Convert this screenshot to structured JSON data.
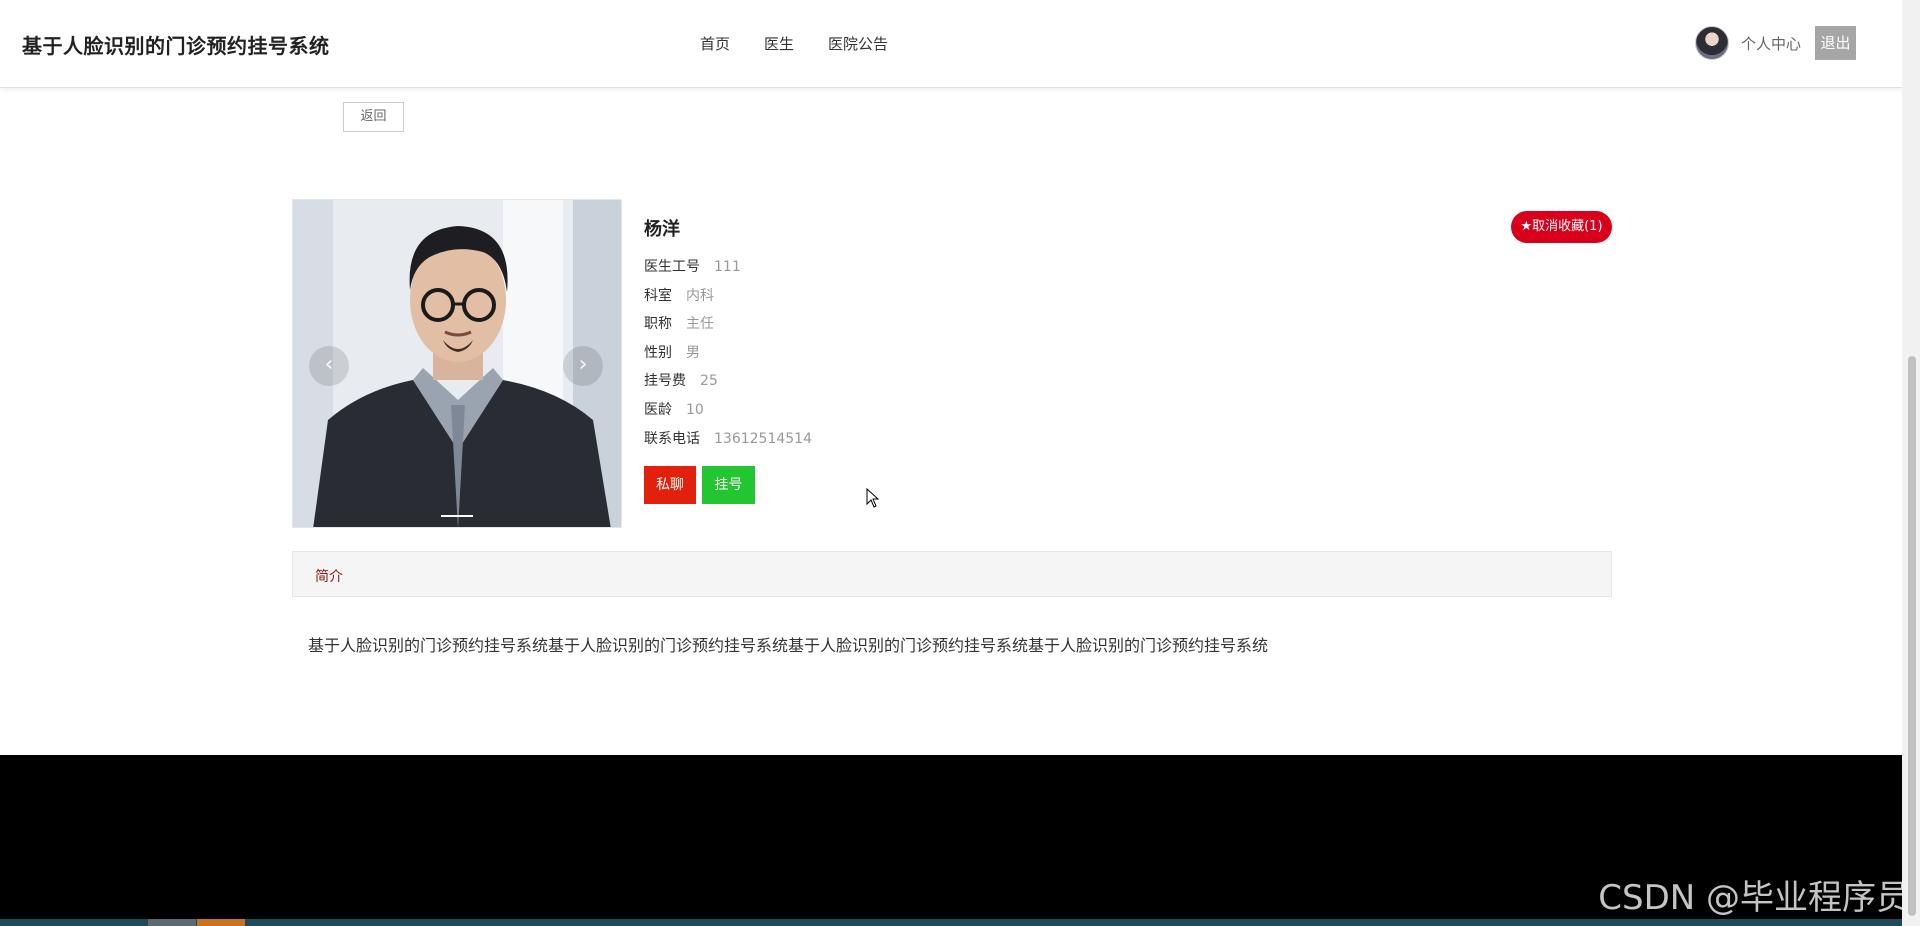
{
  "header": {
    "brand": "基于人脸识别的门诊预约挂号系统",
    "nav": [
      "首页",
      "医生",
      "医院公告"
    ],
    "user_center": "个人中心",
    "logout": "退出"
  },
  "back_label": "返回",
  "doctor": {
    "name": "杨洋",
    "favorite_label": "★取消收藏(1)",
    "fields": [
      {
        "label": "医生工号",
        "value": "111"
      },
      {
        "label": "科室",
        "value": "内科"
      },
      {
        "label": "职称",
        "value": "主任"
      },
      {
        "label": "性别",
        "value": "男"
      },
      {
        "label": "挂号费",
        "value": "25"
      },
      {
        "label": "医龄",
        "value": "10"
      },
      {
        "label": "联系电话",
        "value": "13612514514"
      }
    ],
    "chat_label": "私聊",
    "register_label": "挂号"
  },
  "carousel": {
    "prev_icon": "chevron-left-icon",
    "next_icon": "chevron-right-icon"
  },
  "intro": {
    "tab_label": "简介",
    "text": "基于人脸识别的门诊预约挂号系统基于人脸识别的门诊预约挂号系统基于人脸识别的门诊预约挂号系统基于人脸识别的门诊预约挂号系统"
  },
  "watermark": "CSDN @毕业程序员",
  "colors": {
    "favorite": "#d9001b",
    "chat": "#e3200b",
    "register": "#22c631",
    "intro_tab_text": "#8b1a1a"
  }
}
